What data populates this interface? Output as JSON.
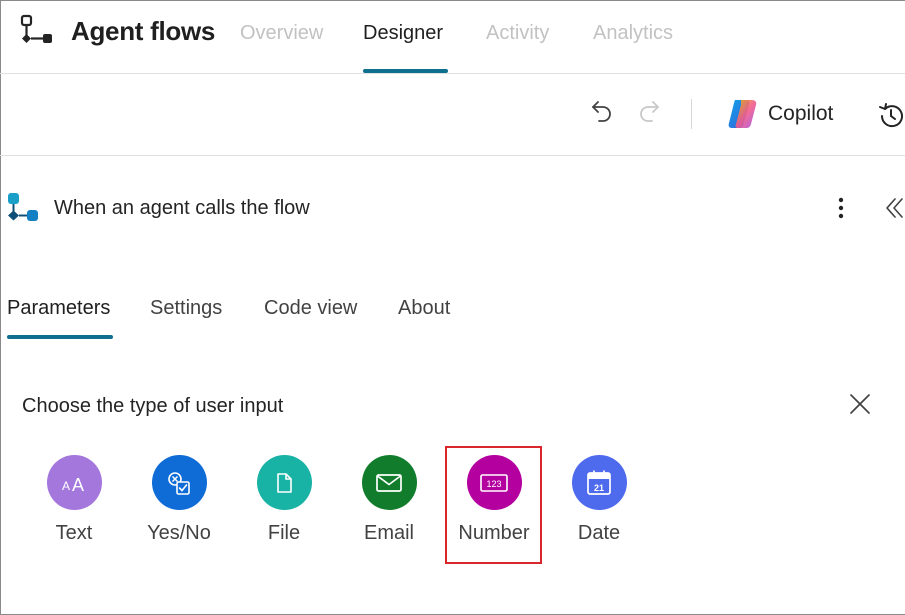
{
  "app": {
    "title": "Agent flows",
    "icon": "flow-app-icon"
  },
  "tabs": [
    {
      "label": "Overview",
      "active": false
    },
    {
      "label": "Designer",
      "active": true
    },
    {
      "label": "Activity",
      "active": false
    },
    {
      "label": "Analytics",
      "active": false
    }
  ],
  "toolbar": {
    "undo_icon": "undo-icon",
    "redo_icon": "redo-icon",
    "copilot_label": "Copilot",
    "history_icon": "history-icon"
  },
  "trigger": {
    "title": "When an agent calls the flow",
    "icon": "agent-trigger-icon"
  },
  "panel_tabs": [
    {
      "label": "Parameters",
      "active": true
    },
    {
      "label": "Settings",
      "active": false
    },
    {
      "label": "Code view",
      "active": false
    },
    {
      "label": "About",
      "active": false
    }
  ],
  "chooser": {
    "title": "Choose the type of user input",
    "options": [
      {
        "label": "Text",
        "icon": "text-icon",
        "color": "#a477dd"
      },
      {
        "label": "Yes/No",
        "icon": "yes-no-icon",
        "color": "#0f6cd6"
      },
      {
        "label": "File",
        "icon": "file-icon",
        "color": "#19b3a6"
      },
      {
        "label": "Email",
        "icon": "email-icon",
        "color": "#117d2c"
      },
      {
        "label": "Number",
        "icon": "number-icon",
        "color": "#b4009e",
        "highlighted": true
      },
      {
        "label": "Date",
        "icon": "calendar-icon",
        "color": "#4f6bed"
      }
    ]
  },
  "colors": {
    "accent": "#0f6f8f",
    "highlight": "#d9262c"
  }
}
